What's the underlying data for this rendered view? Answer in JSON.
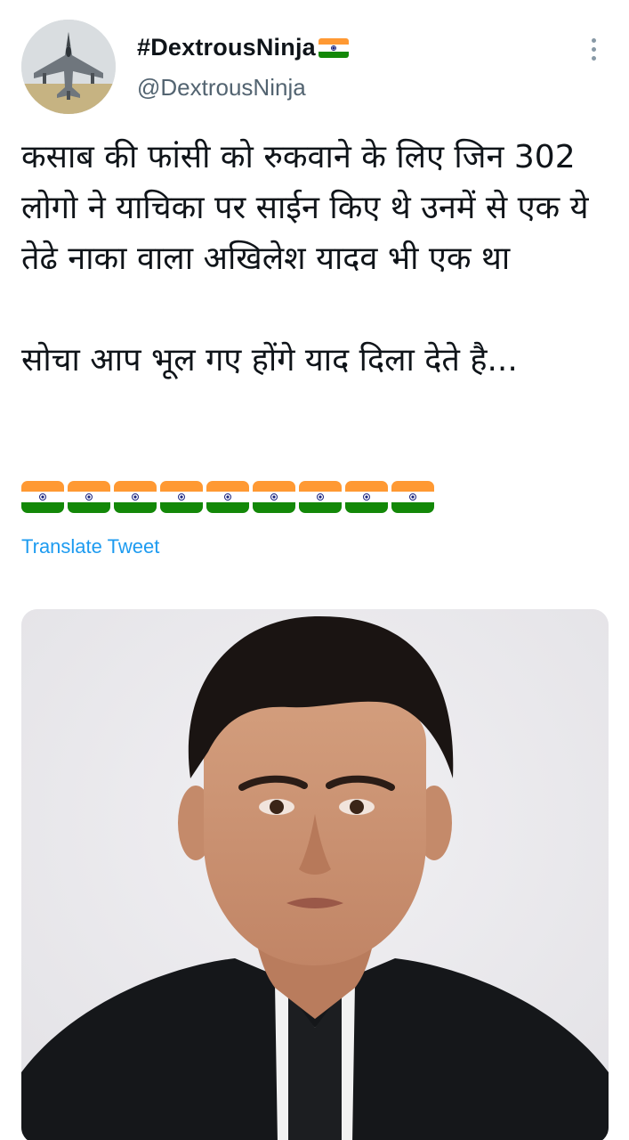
{
  "tweet": {
    "display_name": "#DextrousNinja",
    "handle": "@DextrousNinja",
    "text": "कसाब की फांसी को रुकवाने के लिए जिन 302 लोगो ने याचिका पर साईन किए थे उनमें से एक ये तेढे नाका वाला अखिलेश यादव भी एक था\n\nसोचा आप भूल गए होंगे याद दिला देते है...",
    "flag_emoji_count": 9,
    "translate_label": "Translate Tweet"
  },
  "icons": {
    "more": "more-vertical-icon",
    "flag": "india-flag-icon"
  },
  "colors": {
    "link": "#1d9bf0",
    "handle": "#536471",
    "text": "#0f1419"
  }
}
